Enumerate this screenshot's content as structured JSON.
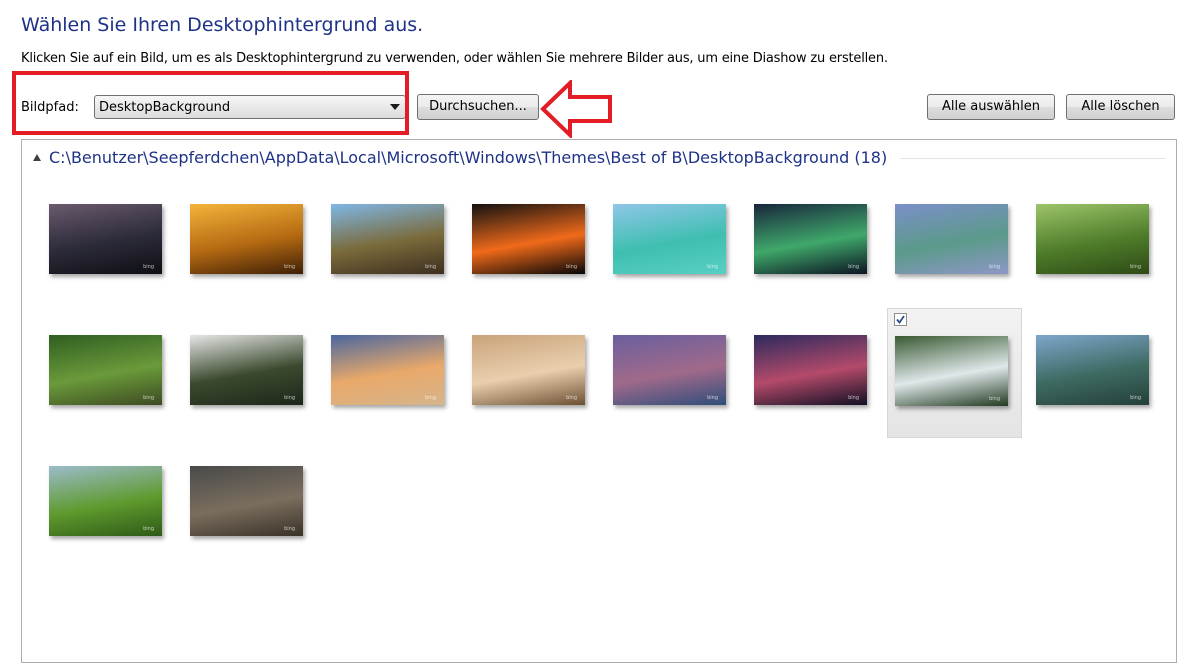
{
  "header": {
    "title": "Wählen Sie Ihren Desktophintergrund aus.",
    "description": "Klicken Sie auf ein Bild, um es als Desktophintergrund zu verwenden, oder wählen Sie mehrere Bilder aus, um eine Diashow zu erstellen."
  },
  "toolbar": {
    "path_label": "Bildpfad:",
    "path_value": "DesktopBackground",
    "browse_label": "Durchsuchen...",
    "select_all_label": "Alle auswählen",
    "clear_all_label": "Alle löschen"
  },
  "gallery": {
    "group_title": "C:\\Benutzer\\Seepferdchen\\AppData\\Local\\Microsoft\\Windows\\Themes\\Best of B\\DesktopBackground (18)",
    "thumbnail_brand": "bing",
    "selected_index": 14,
    "thumbnails": [
      {
        "name": "bridge-dusk",
        "colors": [
          "#6a5a6e",
          "#2b2a38",
          "#0e0e14"
        ]
      },
      {
        "name": "golden-arches-hall",
        "colors": [
          "#f3b43a",
          "#b56a12",
          "#3e1f06"
        ]
      },
      {
        "name": "basalt-coast",
        "colors": [
          "#7fb7e8",
          "#7a6a3a",
          "#3d2e20"
        ]
      },
      {
        "name": "sea-slug",
        "colors": [
          "#111111",
          "#f06a1a",
          "#060606"
        ]
      },
      {
        "name": "tropical-beach",
        "colors": [
          "#8fc6e8",
          "#3fbfb0",
          "#57d0c4"
        ]
      },
      {
        "name": "aurora-town",
        "colors": [
          "#18263c",
          "#3fa86a",
          "#0c1422"
        ]
      },
      {
        "name": "statues-liberty",
        "colors": [
          "#7b8fc8",
          "#5b9a8a",
          "#8d97c6"
        ]
      },
      {
        "name": "hummingbird",
        "colors": [
          "#9dc46a",
          "#4f7d2a",
          "#2e4a16"
        ]
      },
      {
        "name": "park-aerial",
        "colors": [
          "#2f5e22",
          "#6a9a3a",
          "#3d4a22"
        ]
      },
      {
        "name": "ice-floes",
        "colors": [
          "#e6e6e6",
          "#3b4a2e",
          "#1d261a"
        ]
      },
      {
        "name": "beach-boardwalk",
        "colors": [
          "#4a66a0",
          "#e9a96a",
          "#d6b48a"
        ]
      },
      {
        "name": "desert-sunrise",
        "colors": [
          "#c9a37a",
          "#e9cfae",
          "#6d5034"
        ]
      },
      {
        "name": "coastal-village",
        "colors": [
          "#6a5f9e",
          "#a06a8a",
          "#2f4d7a"
        ]
      },
      {
        "name": "night-bat",
        "colors": [
          "#2c2a5e",
          "#b44a6a",
          "#121024"
        ]
      },
      {
        "name": "waterfall",
        "colors": [
          "#3a5a32",
          "#dfe8ea",
          "#223a20"
        ]
      },
      {
        "name": "mountain-lake",
        "colors": [
          "#7ea6cc",
          "#3e6a62",
          "#24403a"
        ]
      },
      {
        "name": "green-hills",
        "colors": [
          "#9bbccb",
          "#5f9a2e",
          "#2e5a16"
        ]
      },
      {
        "name": "storm-city",
        "colors": [
          "#4a4a4a",
          "#7a6e5e",
          "#3a3228"
        ]
      }
    ]
  },
  "colors": {
    "accent_text": "#1e3287",
    "annotation_red": "#e31d25"
  }
}
